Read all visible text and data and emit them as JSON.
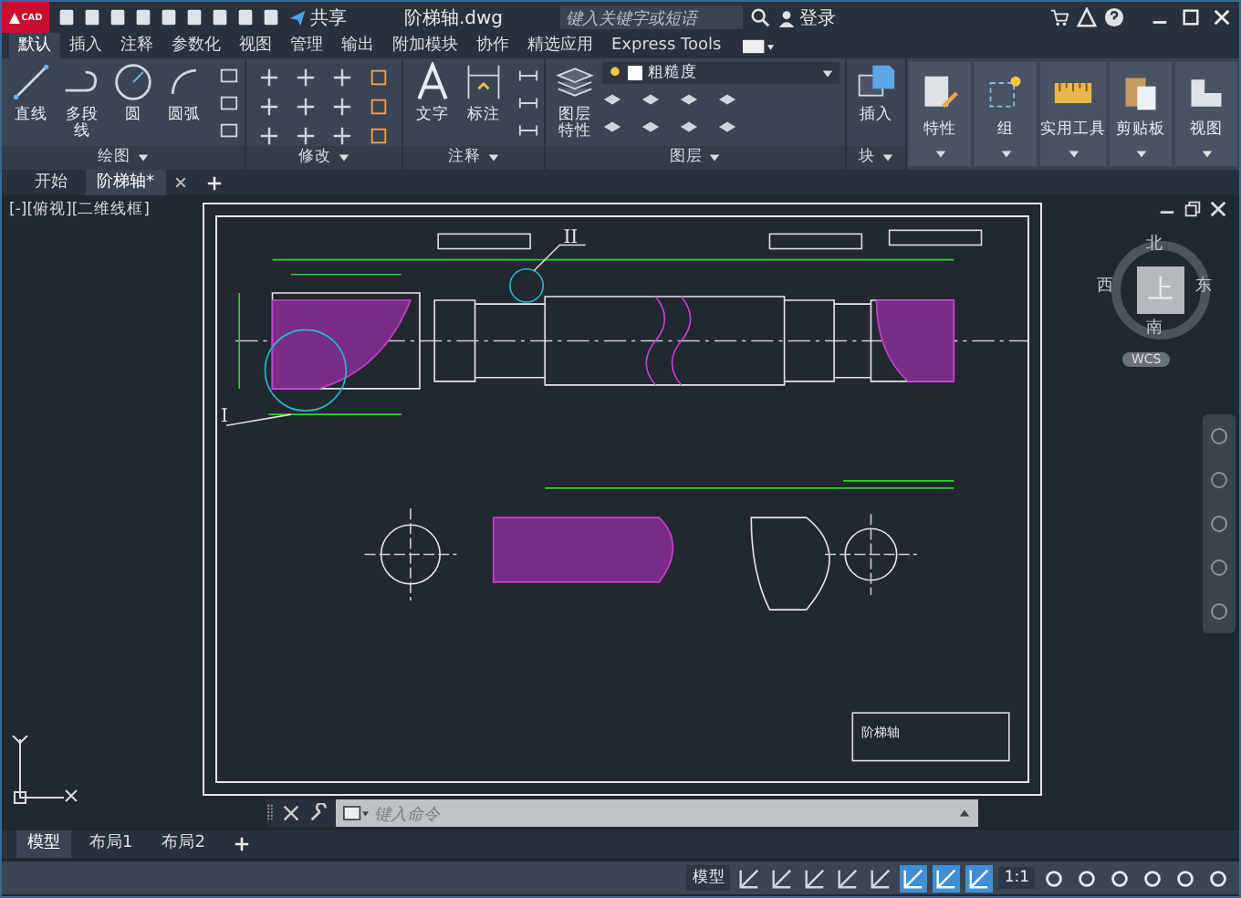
{
  "title_bar": {
    "logo": "CAD",
    "share": "共享",
    "title": "阶梯轴.dwg",
    "search": {
      "placeholder": "键入关键字或短语"
    },
    "login": "登录"
  },
  "ribbon_tabs": [
    {
      "label": "默认",
      "selected": true
    },
    {
      "label": "插入",
      "selected": false
    },
    {
      "label": "注释",
      "selected": false
    },
    {
      "label": "参数化",
      "selected": false
    },
    {
      "label": "视图",
      "selected": false
    },
    {
      "label": "管理",
      "selected": false
    },
    {
      "label": "输出",
      "selected": false
    },
    {
      "label": "附加模块",
      "selected": false
    },
    {
      "label": "协作",
      "selected": false
    },
    {
      "label": "精选应用",
      "selected": false
    },
    {
      "label": "Express Tools",
      "selected": false
    }
  ],
  "ribbon_panels": [
    {
      "title": "绘图",
      "tools": [
        {
          "kind": "line",
          "label": "直线"
        },
        {
          "kind": "polyline",
          "label": "多段线"
        },
        {
          "kind": "circle",
          "label": "圆"
        },
        {
          "kind": "arc",
          "label": "圆弧"
        }
      ]
    },
    {
      "title": "修改"
    },
    {
      "title": "注释",
      "tools": [
        {
          "kind": "text",
          "label": "文字"
        },
        {
          "kind": "dimension",
          "label": "标注"
        }
      ]
    },
    {
      "title": "图层",
      "tools": [
        {
          "kind": "layers",
          "label": "图层特性"
        }
      ],
      "layer": "粗糙度"
    },
    {
      "title": "块",
      "tools": [
        {
          "kind": "insert",
          "label": "插入"
        }
      ]
    }
  ],
  "collapsed_panels": [
    {
      "kind": "properties",
      "label": "特性"
    },
    {
      "kind": "group",
      "label": "组"
    },
    {
      "kind": "utilities",
      "label": "实用工具"
    },
    {
      "kind": "clipboard",
      "label": "剪贴板"
    },
    {
      "kind": "view",
      "label": "视图"
    }
  ],
  "file_tabs": [
    {
      "label": "开始",
      "selected": false
    },
    {
      "label": "阶梯轴*",
      "selected": true
    }
  ],
  "viewport": {
    "label": "[-][俯视][二维线框]",
    "view_cube": {
      "north": "北",
      "south": "南",
      "east": "东",
      "west": "西",
      "top": "上",
      "ucs": "WCS"
    },
    "drawing": {
      "detail_labels": [
        "II",
        "I"
      ],
      "title_block": "阶梯轴"
    }
  },
  "command_line": {
    "placeholder": "键入命令"
  },
  "layout_tabs": [
    {
      "label": "模型",
      "selected": true
    },
    {
      "label": "布局1",
      "selected": false
    },
    {
      "label": "布局2",
      "selected": false
    }
  ],
  "status_bar": {
    "space": "模型",
    "scale": "1:1",
    "toggles": [
      {
        "on": false
      },
      {
        "on": false
      },
      {
        "on": false
      },
      {
        "on": false
      },
      {
        "on": false
      },
      {
        "on": true
      },
      {
        "on": true
      },
      {
        "on": true
      }
    ]
  }
}
